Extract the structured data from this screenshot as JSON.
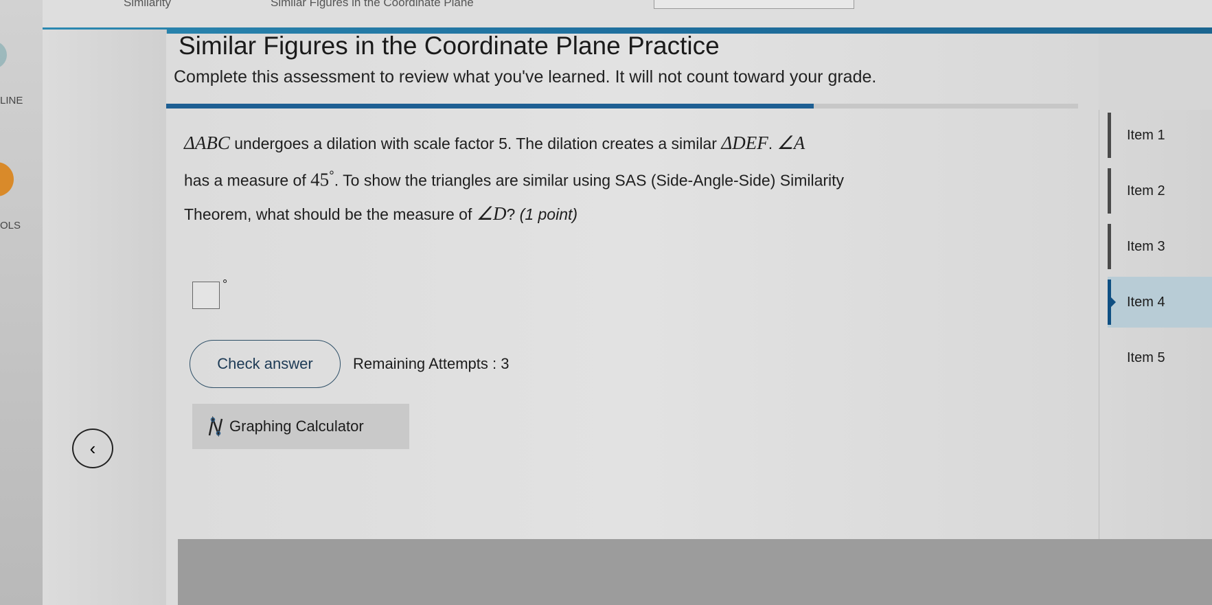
{
  "breadcrumb": {
    "items": [
      "Similarity",
      "Similar Figures in the Coordinate Plane"
    ]
  },
  "left_rail": {
    "items": [
      "LINE",
      "OLS"
    ]
  },
  "header": {
    "title": "Similar Figures in the Coordinate Plane Practice",
    "subtitle": "Complete this assessment to review what you've learned. It will not count toward your grade."
  },
  "progress": {
    "percent": 71
  },
  "question": {
    "line1": {
      "tri1": "ΔABC",
      "text1": " undergoes a dilation with scale factor 5. The dilation creates a similar ",
      "tri2": "ΔDEF",
      "text2": ". ",
      "angle": "∠A"
    },
    "line2": {
      "text1": "has a measure of ",
      "value": "45",
      "deg": "°",
      "text2": ". To show the triangles are similar using SAS (Side-Angle-Side) Similarity"
    },
    "line3": {
      "text1": "Theorem, what should be the measure of ",
      "angle": "∠D",
      "text2": "? ",
      "points": "(1 point)"
    }
  },
  "answer": {
    "value": "",
    "unit": "°"
  },
  "actions": {
    "check_label": "Check answer",
    "attempts": "Remaining Attempts : 3",
    "calculator_label": "Graphing Calculator"
  },
  "items": [
    {
      "label": "Item 1",
      "active": false
    },
    {
      "label": "Item 2",
      "active": false
    },
    {
      "label": "Item 3",
      "active": false
    },
    {
      "label": "Item 4",
      "active": true
    },
    {
      "label": "Item 5",
      "active": false
    }
  ],
  "colors": {
    "accent": "#1e5f93",
    "top_bar": "#2b88b0",
    "active_item": "#b8ccd6",
    "rail_icon": "#d98a2a"
  }
}
